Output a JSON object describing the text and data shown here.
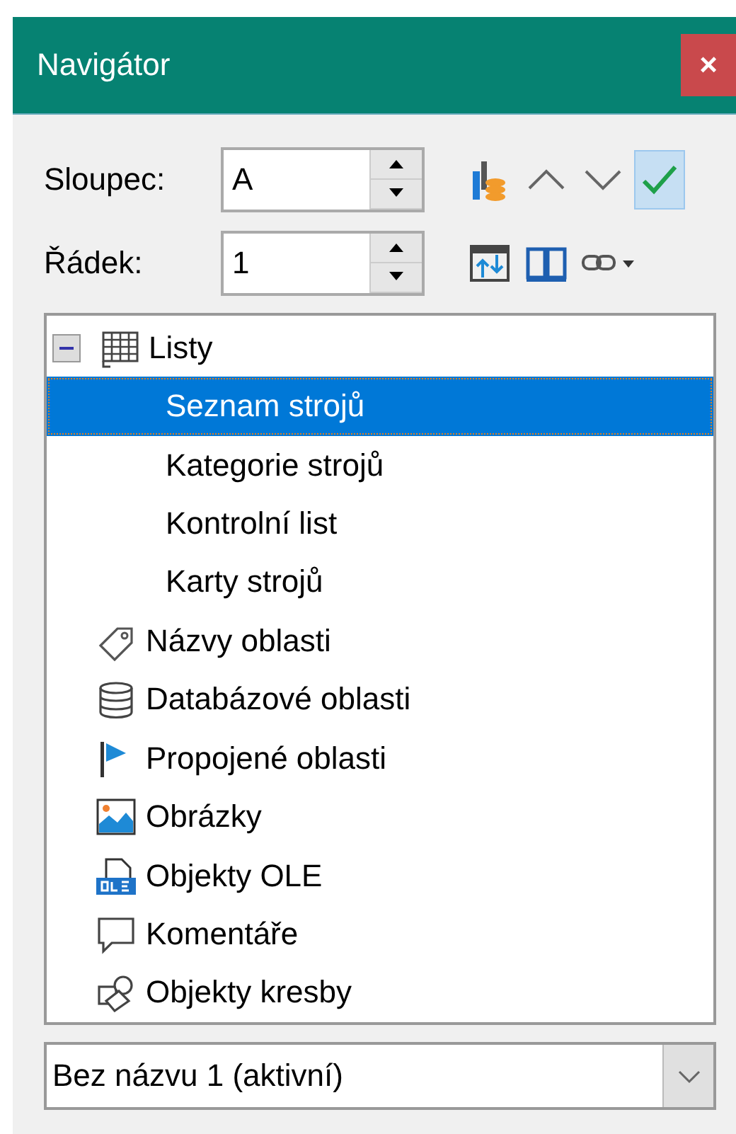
{
  "window": {
    "title": "Navigátor",
    "close": "×"
  },
  "fields": [
    {
      "label": "Sloupec:",
      "value": "A"
    },
    {
      "label": "Řádek:",
      "value": "1"
    }
  ],
  "toolbar": [
    {
      "kind": "data",
      "on": false
    },
    {
      "kind": "up",
      "on": false
    },
    {
      "kind": "down",
      "on": false
    },
    {
      "kind": "check",
      "on": true
    },
    {
      "kind": "toggle",
      "on": false
    },
    {
      "kind": "book",
      "on": false
    },
    {
      "kind": "link",
      "on": false
    }
  ],
  "tree": [
    {
      "label": "Listy",
      "kind": "sheet",
      "expanded": true,
      "selected": false,
      "children": [
        {
          "label": "Seznam strojů",
          "selected": true
        },
        {
          "label": "Kategorie strojů",
          "selected": false
        },
        {
          "label": "Kontrolní list",
          "selected": false
        },
        {
          "label": "Karty strojů",
          "selected": false
        }
      ]
    },
    {
      "label": "Názvy oblasti",
      "kind": "tag",
      "selected": false
    },
    {
      "label": "Databázové oblasti",
      "kind": "db",
      "selected": false
    },
    {
      "label": "Propojené oblasti",
      "kind": "flag",
      "selected": false
    },
    {
      "label": "Obrázky",
      "kind": "image",
      "selected": false
    },
    {
      "label": "Objekty OLE",
      "kind": "ole",
      "selected": false
    },
    {
      "label": "Komentáře",
      "kind": "comment",
      "selected": false
    },
    {
      "label": "Objekty kresby",
      "kind": "shapes",
      "selected": false
    }
  ],
  "document": {
    "value": "Bez názvu 1 (aktivní)"
  }
}
